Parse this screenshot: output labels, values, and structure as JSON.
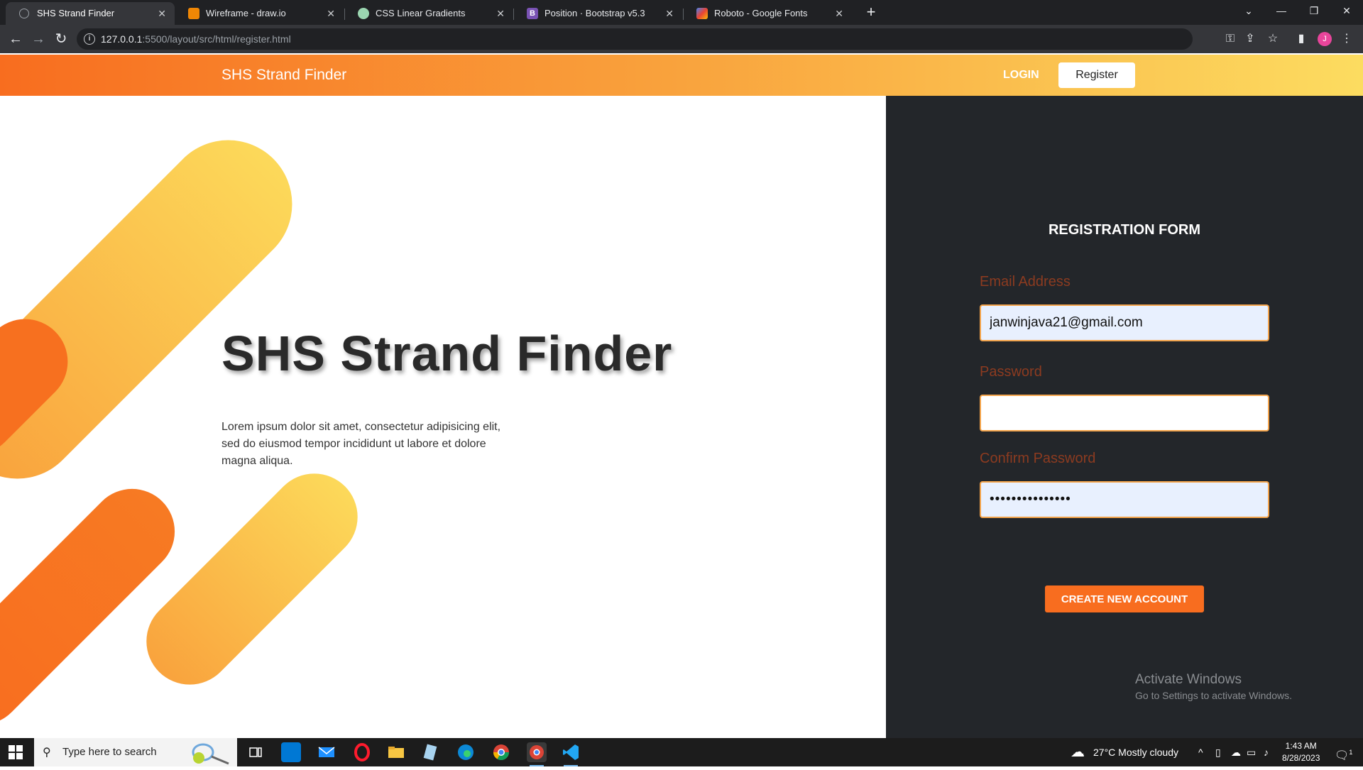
{
  "browser": {
    "tabs": [
      {
        "title": "SHS Strand Finder",
        "icon": "globe-icon",
        "color": "#5f6368",
        "active": true
      },
      {
        "title": "Wireframe - draw.io",
        "icon": "drawio-icon",
        "color": "#f08705",
        "active": false
      },
      {
        "title": "CSS Linear Gradients",
        "icon": "gradient-icon",
        "color": "#9bd6b1",
        "active": false
      },
      {
        "title": "Position · Bootstrap v5.3",
        "icon": "bootstrap-icon",
        "color": "#7952b3",
        "active": false
      },
      {
        "title": "Roboto - Google Fonts",
        "icon": "google-fonts-icon",
        "color": "#4285f4",
        "active": false
      }
    ],
    "url_host": "127.0.0.1",
    "url_path": ":5500/layout/src/html/register.html",
    "profile_initial": "J"
  },
  "site": {
    "brand": "SHS Strand Finder",
    "nav": {
      "login": "LOGIN",
      "register": "Register"
    },
    "colors": {
      "gradient_start": "#f86d1f",
      "gradient_end": "#fcdc60",
      "panel_bg": "#23262a"
    }
  },
  "hero": {
    "title": "SHS Strand Finder",
    "text": "Lorem ipsum dolor sit amet, consectetur adipisicing elit, sed do eiusmod tempor incididunt ut labore et dolore magna aliqua."
  },
  "form": {
    "title": "REGISTRATION FORM",
    "email_label": "Email Address",
    "email_value": "janwinjava21@gmail.com",
    "password_label": "Password",
    "password_value": "",
    "confirm_label": "Confirm Password",
    "confirm_value": "•••••••••••••••",
    "submit": "CREATE NEW ACCOUNT"
  },
  "watermark": {
    "line1": "Activate Windows",
    "line2": "Go to Settings to activate Windows."
  },
  "taskbar": {
    "search_placeholder": "Type here to search",
    "weather": "27°C  Mostly cloudy",
    "time": "1:43 AM",
    "date": "8/28/2023",
    "notification_count": "1"
  }
}
